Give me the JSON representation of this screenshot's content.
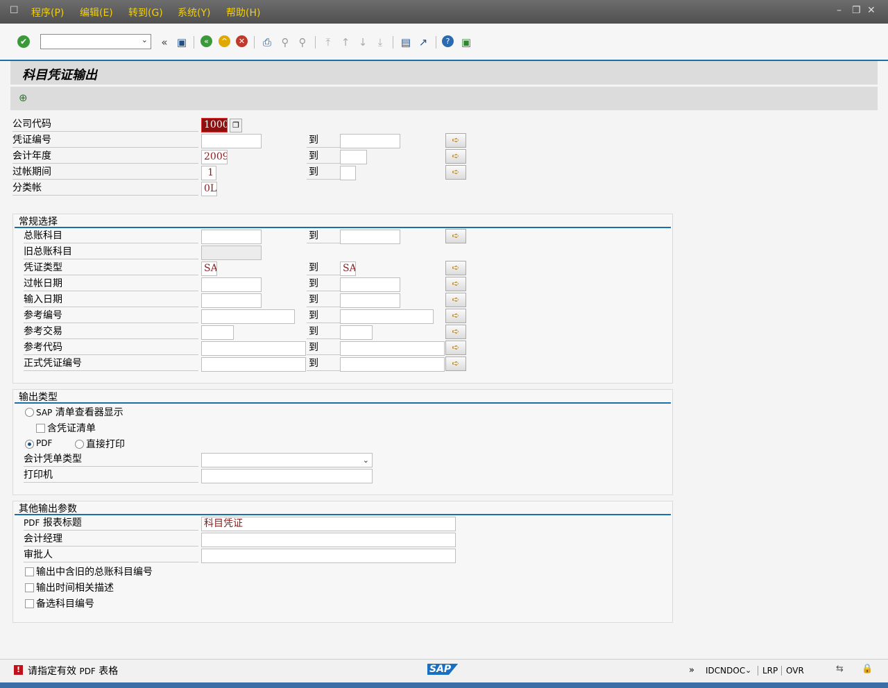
{
  "menubar": {
    "items": [
      "程序(P)",
      "编辑(E)",
      "转到(G)",
      "系统(Y)",
      "帮助(H)"
    ]
  },
  "toolbar": {
    "command_value": "",
    "icons": [
      "enter-icon",
      "back-icon",
      "save-icon",
      "back-nav-icon",
      "exit-icon",
      "cancel-icon",
      "print-icon",
      "find-icon",
      "find-next-icon",
      "first-page-icon",
      "prev-page-icon",
      "next-page-icon",
      "last-page-icon",
      "new-session-icon",
      "shortcut-icon",
      "help-icon",
      "customize-icon"
    ]
  },
  "title": "科目凭证输出",
  "header_fields": {
    "company_code": {
      "label": "公司代码",
      "value": "1000"
    },
    "doc_number": {
      "label": "凭证编号",
      "value": "",
      "to": "到",
      "to_value": ""
    },
    "fiscal_year": {
      "label": "会计年度",
      "value": "2009",
      "to": "到",
      "to_value": ""
    },
    "posting_period": {
      "label": "过帐期间",
      "value": "1",
      "to": "到",
      "to_value": ""
    },
    "ledger": {
      "label": "分类帐",
      "value": "0L"
    }
  },
  "general": {
    "title": "常规选择",
    "rows": [
      {
        "label": "总账科目",
        "value": "",
        "to": "到",
        "to_value": ""
      },
      {
        "label": "旧总账科目",
        "value": ""
      },
      {
        "label": "凭证类型",
        "value": "SA",
        "to": "到",
        "to_value": "SA"
      },
      {
        "label": "过帐日期",
        "value": "",
        "to": "到",
        "to_value": ""
      },
      {
        "label": "输入日期",
        "value": "",
        "to": "到",
        "to_value": ""
      },
      {
        "label": "参考编号",
        "value": "",
        "to": "到",
        "to_value": ""
      },
      {
        "label": "参考交易",
        "value": "",
        "to": "到",
        "to_value": ""
      },
      {
        "label": "参考代码",
        "value": "",
        "to": "到",
        "to_value": ""
      },
      {
        "label": "正式凭证编号",
        "value": "",
        "to": "到",
        "to_value": ""
      }
    ]
  },
  "output": {
    "title": "输出类型",
    "sap_list_prefix": "SAP",
    "sap_list_label": "清单查看器显示",
    "include_doc_list": "含凭证清单",
    "pdf_label": "PDF",
    "direct_print_label": "直接打印",
    "form_type_label": "会计凭单类型",
    "form_type_value": "",
    "printer_label": "打印机",
    "printer_value": ""
  },
  "other": {
    "title": "其他输出参数",
    "pdf_title_prefix": "PDF",
    "pdf_title_label": "报表标题",
    "pdf_title_value": "科目凭证",
    "accountant_label": "会计经理",
    "accountant_value": "",
    "approver_label": "审批人",
    "approver_value": "",
    "chk_old_account": "输出中含旧的总账科目编号",
    "chk_time_desc": "输出时间相关描述",
    "chk_alt_account": "备选科目编号"
  },
  "status": {
    "message_prefix": "请指定有效",
    "message_pdf": "PDF",
    "message_suffix": "表格",
    "sap_logo": "SAP",
    "arrows": "»",
    "transaction": "IDCNDOC",
    "server": "LRP",
    "mode": "OVR"
  }
}
